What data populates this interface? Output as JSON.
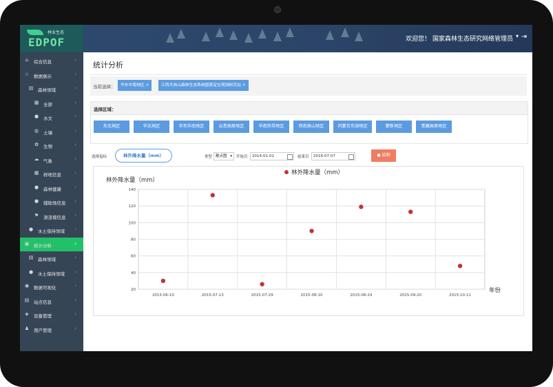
{
  "header": {
    "logo_text": "EDPOF",
    "logo_subtitle": "林业生态",
    "welcome": "欢迎您！ 国家森林生态研究网络管理员",
    "dropdown_icon": "chevron-down-icon",
    "logout_icon": "logout-icon"
  },
  "sidebar": {
    "items": [
      {
        "label": "综合信息",
        "icon": "home-icon",
        "level": 0,
        "active": false
      },
      {
        "label": "数据展示",
        "icon": "star-icon",
        "level": 0,
        "active": false
      },
      {
        "label": "森林领域",
        "icon": "list-icon",
        "level": 1,
        "active": false
      },
      {
        "label": "全部",
        "icon": "grid-icon",
        "level": 2,
        "active": false
      },
      {
        "label": "水文",
        "icon": "dot-icon",
        "level": 2,
        "active": false
      },
      {
        "label": "土壤",
        "icon": "globe-icon",
        "level": 2,
        "active": false
      },
      {
        "label": "生物",
        "icon": "leaf-icon",
        "level": 2,
        "active": false
      },
      {
        "label": "气象",
        "icon": "cloud-icon",
        "level": 2,
        "active": false
      },
      {
        "label": "样地信息",
        "icon": "grid-icon",
        "level": 2,
        "active": false
      },
      {
        "label": "森林健康",
        "icon": "drop-icon",
        "level": 2,
        "active": false
      },
      {
        "label": "辅助场信息",
        "icon": "drop-icon",
        "level": 2,
        "active": false
      },
      {
        "label": "测流堰信息",
        "icon": "flag-icon",
        "level": 2,
        "active": false
      },
      {
        "label": "水土保持领域",
        "icon": "dot-icon",
        "level": 1,
        "active": false
      },
      {
        "label": "统计分析",
        "icon": "calendar-icon",
        "level": 0,
        "active": true
      },
      {
        "label": "森林领域",
        "icon": "list-icon",
        "level": 1,
        "active": false
      },
      {
        "label": "水土保持领域",
        "icon": "dot-icon",
        "level": 1,
        "active": false
      },
      {
        "label": "数据可视化",
        "icon": "eye-icon",
        "level": 0,
        "active": false
      },
      {
        "label": "站点信息",
        "icon": "list-icon",
        "level": 0,
        "active": false
      },
      {
        "label": "设备管理",
        "icon": "tag-icon",
        "level": 0,
        "active": false
      },
      {
        "label": "用户管理",
        "icon": "user-icon",
        "level": 0,
        "active": false
      }
    ]
  },
  "main": {
    "title": "统计分析",
    "current_label": "当前选择：",
    "tags": [
      "华东中南地区 ×",
      "江西大岗山森林生态系统国家定位观测研究站 ×"
    ],
    "region_heading": "选择区域：",
    "regions": [
      "东北地区",
      "华北地区",
      "华东中南地区",
      "云贵高原地区",
      "华南热带地区",
      "西南高山地区",
      "内蒙古东部地区",
      "蒙新地区",
      "青藏高原地区"
    ],
    "indicator_label": "选择指标",
    "indicator_value": "林外降水量（mm）",
    "type_label": "类型",
    "type_value": "散点图",
    "start_label": "开始日",
    "start_value": "2014-01-01",
    "end_label": "结束日",
    "end_value": "2016-07-07",
    "draw_button": "绘制",
    "draw_icon": "drop-icon"
  },
  "chart_data": {
    "type": "scatter",
    "title": "",
    "ylabel": "林外降水量（mm）",
    "xlabel": "年份",
    "legend": [
      "林外降水量（mm）"
    ],
    "series": [
      {
        "name": "林外降水量（mm）",
        "color": "#c23531",
        "x": [
          "2015-06-10",
          "2015-07-13",
          "2015-07-29",
          "2015-08-10",
          "2015-08-24",
          "2015-09-20",
          "2015-10-11"
        ],
        "y": [
          30,
          133,
          26,
          90,
          119,
          113,
          48
        ]
      }
    ],
    "categories": [
      "2015-06-10",
      "2015-07-13",
      "2015-07-29",
      "2015-08-10",
      "2015-08-24",
      "2015-09-20",
      "2015-10-11"
    ],
    "ylim": [
      20,
      140
    ],
    "yticks": [
      "20",
      "40",
      "60",
      "80",
      "100",
      "120",
      "140"
    ],
    "grid": true
  }
}
